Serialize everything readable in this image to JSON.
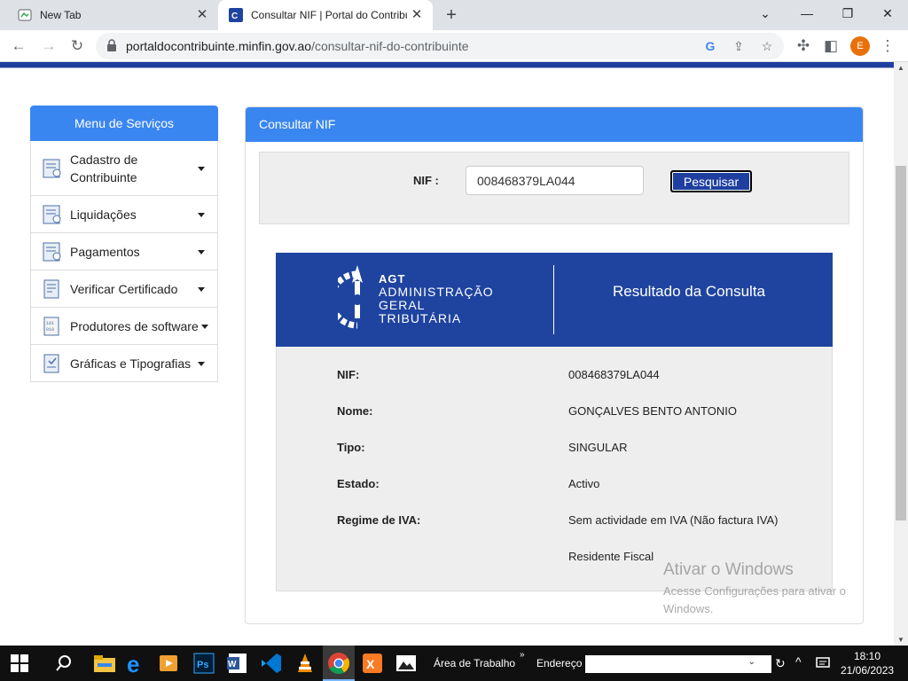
{
  "browser": {
    "tabs": [
      {
        "label": "New Tab",
        "icon": "new-tab-icon"
      },
      {
        "label": "Consultar NIF | Portal do Contribuinte",
        "icon": "portal-favicon"
      }
    ],
    "url_host": "portaldocontribuinte.minfin.gov.ao",
    "url_path": "/consultar-nif-do-contribuinte",
    "profile_initial": "E"
  },
  "sidebar": {
    "title": "Menu de Serviços",
    "items": [
      {
        "label": "Cadastro de Contribuinte",
        "icon": "register-form-icon"
      },
      {
        "label": "Liquidações",
        "icon": "settlement-form-icon"
      },
      {
        "label": "Pagamentos",
        "icon": "payment-form-icon"
      },
      {
        "label": "Verificar Certificado",
        "icon": "certificate-icon"
      },
      {
        "label": "Produtores de software",
        "icon": "software-icon"
      },
      {
        "label": "Gráficas e Tipografias",
        "icon": "print-shop-icon"
      }
    ]
  },
  "main": {
    "title": "Consultar NIF",
    "nif_label": "NIF :",
    "nif_value": "008468379LA044",
    "search_button": "Pesquisar"
  },
  "result": {
    "logo_abbr": "AGT",
    "logo_line1": "ADMINISTRAÇÃO",
    "logo_line2": "GERAL",
    "logo_line3": "TRIBUTÁRIA",
    "title": "Resultado da Consulta",
    "rows": [
      {
        "label": "NIF:",
        "value": "008468379LA044"
      },
      {
        "label": "Nome:",
        "value": "GONÇALVES BENTO ANTONIO"
      },
      {
        "label": "Tipo:",
        "value": "SINGULAR"
      },
      {
        "label": "Estado:",
        "value": "Activo"
      },
      {
        "label": "Regime de IVA:",
        "value": "Sem actividade em IVA (Não factura IVA)"
      },
      {
        "label": "",
        "value": "Residente Fiscal"
      }
    ]
  },
  "watermark": {
    "line1": "Ativar o Windows",
    "line2": "Acesse Configurações para ativar o",
    "line3": "Windows."
  },
  "taskbar": {
    "desktop_label": "Área de Trabalho",
    "address_label": "Endereço",
    "time": "18:10",
    "date": "21/06/2023"
  },
  "colors": {
    "header_blue": "#3a86f0",
    "agt_navy": "#1f44a0",
    "button_navy": "#1f3fa0"
  }
}
